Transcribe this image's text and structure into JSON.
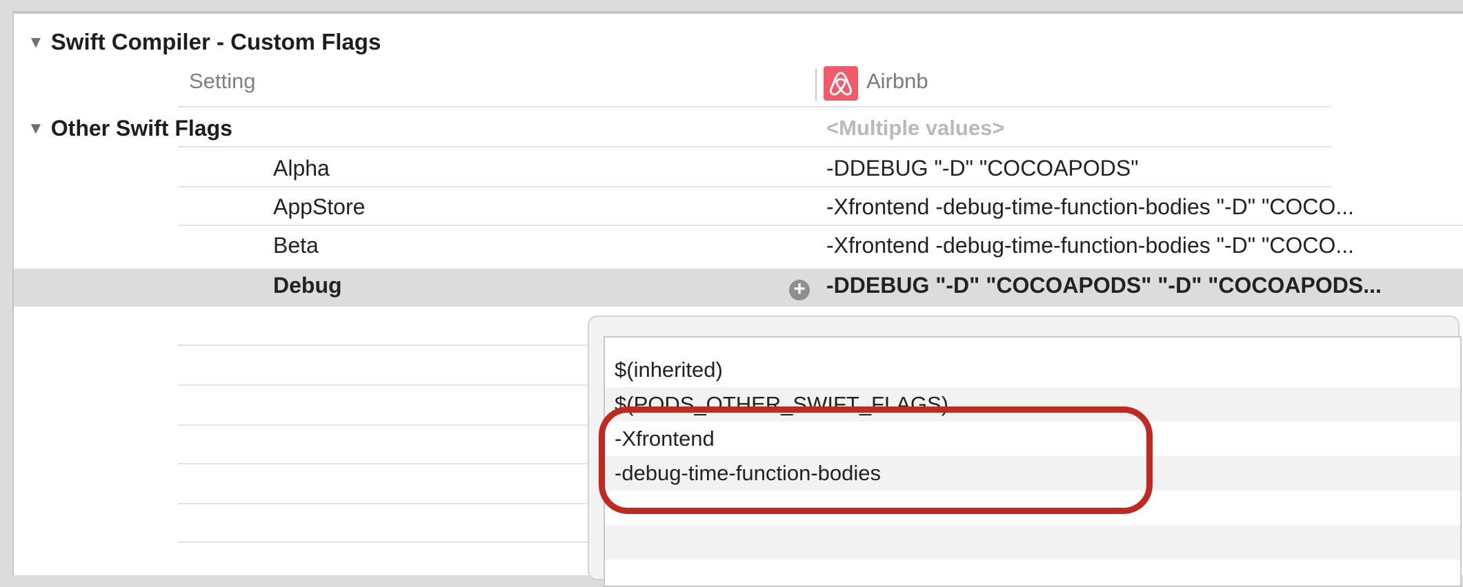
{
  "section": {
    "title": "Swift Compiler - Custom Flags",
    "column_setting": "Setting",
    "column_target": "Airbnb",
    "target_icon": "airbnb-logo-icon",
    "target_icon_color": "#f25a69"
  },
  "other_swift_flags": {
    "title": "Other Swift Flags",
    "summary_value": "<Multiple values>",
    "rows": [
      {
        "label": "Alpha",
        "value": "-DDEBUG  \"-D\" \"COCOAPODS\""
      },
      {
        "label": "AppStore",
        "value": "-Xfrontend -debug-time-function-bodies  \"-D\" \"COCO..."
      },
      {
        "label": "Beta",
        "value": "-Xfrontend -debug-time-function-bodies  \"-D\" \"COCO..."
      },
      {
        "label": "Debug",
        "value": "-DDEBUG  \"-D\" \"COCOAPODS\"  \"-D\" \"COCOAPODS..."
      }
    ],
    "selected_row": "Debug",
    "add_icon": "plus-circle-icon"
  },
  "popover": {
    "values": [
      "$(inherited)",
      "$(PODS_OTHER_SWIFT_FLAGS)",
      "-Xfrontend",
      "-debug-time-function-bodies"
    ]
  },
  "highlight_color": "#c0291f"
}
